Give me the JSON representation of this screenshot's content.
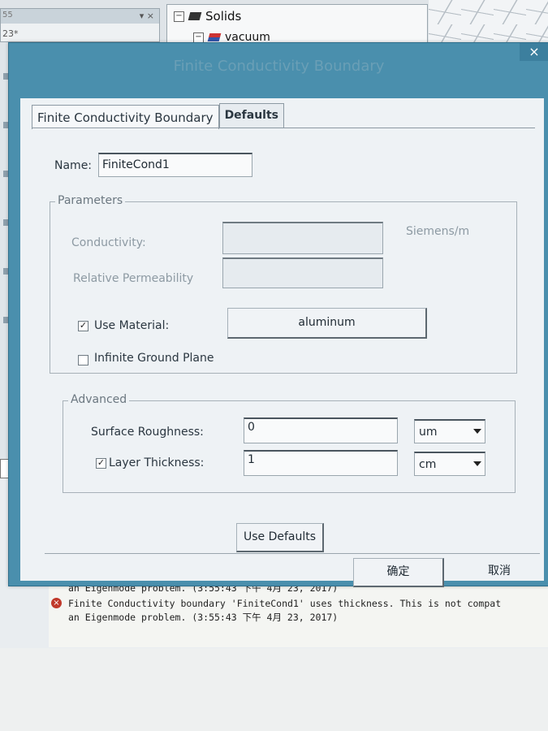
{
  "background": {
    "tree": {
      "solids_label": "Solids",
      "vacuum_label": "vacuum"
    },
    "left_fragment": "23*",
    "left_header_fragment": "55"
  },
  "dialog": {
    "title": "Finite Conductivity Boundary",
    "close_label": "×",
    "tabs": [
      {
        "label": "Finite Conductivity Boundary",
        "active": true
      },
      {
        "label": "Defaults",
        "active": false
      }
    ],
    "name_label": "Name:",
    "name_value": "FiniteCond1",
    "parameters": {
      "title": "Parameters",
      "conductivity_label": "Conductivity:",
      "conductivity_value": "",
      "conductivity_unit": "Siemens/m",
      "permeability_label": "Relative Permeability",
      "permeability_value": "",
      "use_material_label": "Use Material:",
      "use_material_checked": true,
      "material_button": "aluminum",
      "infinite_ground_label": "Infinite Ground Plane",
      "infinite_ground_checked": false
    },
    "advanced": {
      "title": "Advanced",
      "roughness_label": "Surface Roughness:",
      "roughness_value": "0",
      "roughness_unit": "um",
      "thickness_label": "Layer Thickness:",
      "thickness_checked": true,
      "thickness_value": "1",
      "thickness_unit": "cm"
    },
    "use_defaults_button": "Use Defaults",
    "ok_button": "确定",
    "cancel_button": "取消"
  },
  "log": {
    "line1": "an Eigenmode problem.  (3:55:43 下午  4月 23, 2017)",
    "line2": "Finite Conductivity boundary 'FiniteCond1' uses thickness.   This is not compat",
    "line3": "an Eigenmode problem.  (3:55:43 下午  4月 23, 2017)"
  },
  "colors": {
    "title_bar": "#4a8fad",
    "dialog_body": "#eef2f5",
    "error_icon": "#c0392b"
  }
}
